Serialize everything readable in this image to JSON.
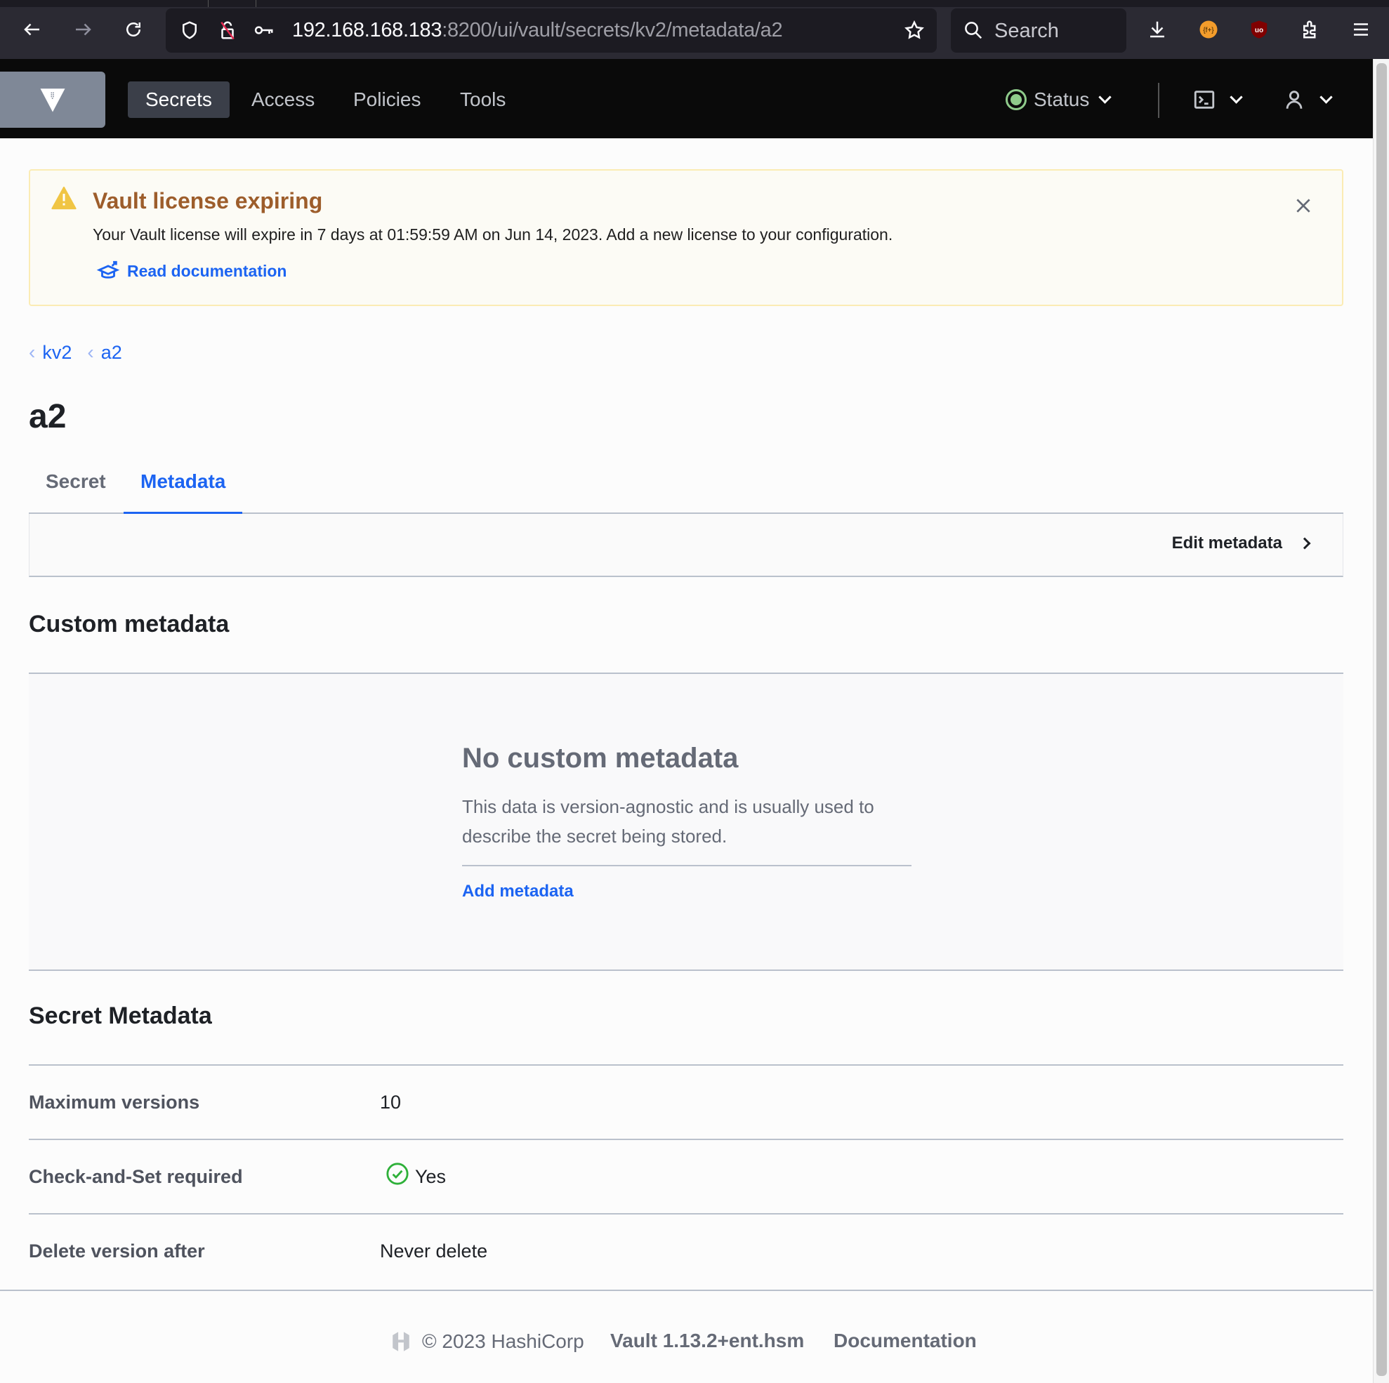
{
  "browser": {
    "url_host": "192.168.168.183",
    "url_path": ":8200/ui/vault/secrets/kv2/metadata/a2",
    "search_placeholder": "Search",
    "icons": [
      "back-icon",
      "forward-icon",
      "reload-icon",
      "shield-icon",
      "insecure-lock-icon",
      "key-icon",
      "bookmark-star-icon",
      "search-icon",
      "download-icon",
      "extension-fplus-icon",
      "ublock-icon",
      "extensions-puzzle-icon",
      "menu-icon"
    ]
  },
  "nav": {
    "items": [
      {
        "label": "Secrets",
        "active": true
      },
      {
        "label": "Access",
        "active": false
      },
      {
        "label": "Policies",
        "active": false
      },
      {
        "label": "Tools",
        "active": false
      }
    ],
    "status_label": "Status",
    "status_color": "#8fcb8b"
  },
  "banner": {
    "title": "Vault license expiring",
    "message": "Your Vault license will expire in 7 days at 01:59:59 AM on Jun 14, 2023. Add a new license to your configuration.",
    "link": "Read documentation",
    "close_label": "×"
  },
  "breadcrumb": [
    {
      "label": "kv2"
    },
    {
      "label": "a2"
    }
  ],
  "page": {
    "title": "a2",
    "tabs": [
      {
        "label": "Secret",
        "active": false
      },
      {
        "label": "Metadata",
        "active": true
      }
    ],
    "edit_metadata_label": "Edit metadata"
  },
  "custom_metadata": {
    "heading": "Custom metadata",
    "empty_title": "No custom metadata",
    "empty_message": "This data is version-agnostic and is usually used to describe the secret being stored.",
    "add_label": "Add metadata"
  },
  "secret_metadata": {
    "heading": "Secret Metadata",
    "rows": [
      {
        "key": "Maximum versions",
        "value": "10"
      },
      {
        "key": "Check-and-Set required",
        "value": "Yes",
        "icon": "check-circle-icon"
      },
      {
        "key": "Delete version after",
        "value": "Never delete"
      }
    ]
  },
  "footer": {
    "copyright": "© 2023 HashiCorp",
    "version": "Vault 1.13.2+ent.hsm",
    "docs_link": "Documentation"
  },
  "colors": {
    "accent": "#1c64f2",
    "warning_title": "#9d5d2b",
    "success": "#2eb039"
  }
}
